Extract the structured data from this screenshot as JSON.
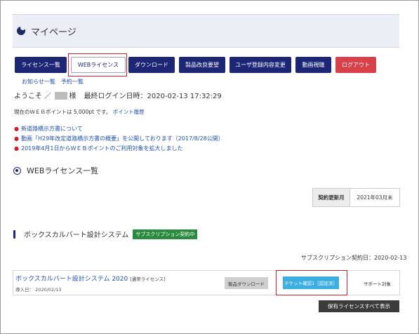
{
  "header": {
    "title": "マイページ"
  },
  "nav": {
    "items": [
      {
        "label": "ライセンス一覧"
      },
      {
        "label": "WEBライセンス"
      },
      {
        "label": "ダウンロード"
      },
      {
        "label": "製品改良要望"
      },
      {
        "label": "ユーザ登録内容変更"
      },
      {
        "label": "動画視聴"
      },
      {
        "label": "ログアウト"
      }
    ],
    "active_index": 1
  },
  "sublinks": [
    "お知らせ一覧",
    "予約一覧"
  ],
  "welcome": {
    "prefix": "ようこそ ／",
    "suffix": "様",
    "login_label": "最終ログイン日時：2020-02-13 17:32:29"
  },
  "points": {
    "text": "現在のＷＥＢポイントは 5,000pt です。",
    "history_link": "ポイント履歴"
  },
  "news": [
    "新道路橋示方書について",
    "動画「H29年改定道路橋示方書の概要」を公開しております（2017/8/28公開）",
    "2019年4月1日からＷＥＢポイントのご利用対象を拡大しました"
  ],
  "section": {
    "title": "WEBライセンス一覧"
  },
  "contract_update": {
    "label": "契約更新月",
    "value": "2021年03月末"
  },
  "product_group": {
    "title": "ボックスカルバート設計システム",
    "badge": "サブスクリプション契約中"
  },
  "subscription": {
    "contract_date": "サブスクリプション契約日：2020-02-13"
  },
  "product": {
    "name": "ボックスカルバート設計システム 2020",
    "license_tag": "[通常ライセンス]",
    "install_date": "導入日： 2020/02/13",
    "download_label": "製品ダウンロード",
    "ticket_label": "チケット確認1［認証済］",
    "support_label": "サポート対象"
  },
  "show_all_label": "保有ライセンスすべて表示",
  "colors": {
    "nav": "#1c2675",
    "logout": "#d9414a",
    "highlight": "#c8202d",
    "badge": "#2a8a3e",
    "ticket": "#3daee2"
  }
}
